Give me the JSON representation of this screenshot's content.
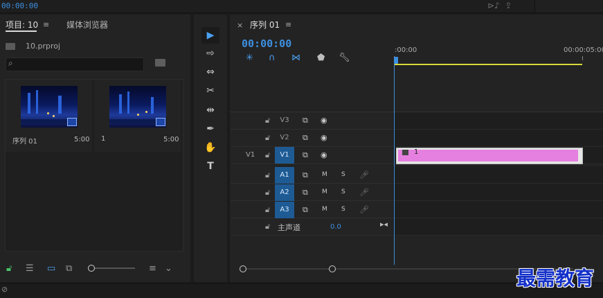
{
  "top_bar": {
    "timecode": "00:00:00"
  },
  "project_panel": {
    "tab_project": "项目: 10",
    "tab_media_browser": "媒体浏览器",
    "project_file": "10.prproj",
    "search_placeholder": "",
    "items": [
      {
        "name": "序列 01",
        "duration": "5:00"
      },
      {
        "name": "1",
        "duration": "5:00"
      }
    ]
  },
  "tools": [
    {
      "icon": "selection-tool-icon",
      "glyph": "▶"
    },
    {
      "icon": "track-select-tool-icon",
      "glyph": "⇨"
    },
    {
      "icon": "ripple-edit-tool-icon",
      "glyph": "↔"
    },
    {
      "icon": "razor-tool-icon",
      "glyph": "✂"
    },
    {
      "icon": "slip-tool-icon",
      "glyph": "⇹"
    },
    {
      "icon": "pen-tool-icon",
      "glyph": "✒"
    },
    {
      "icon": "hand-tool-icon",
      "glyph": "✋"
    },
    {
      "icon": "type-tool-icon",
      "glyph": "T"
    }
  ],
  "timeline": {
    "sequence_tab": "序列 01",
    "timecode": "00:00:00",
    "ruler_start": ":00:00",
    "ruler_end": "00:00:05:00",
    "video_tracks": [
      {
        "source": "",
        "name": "V3"
      },
      {
        "source": "",
        "name": "V2"
      },
      {
        "source": "V1",
        "name": "V1"
      }
    ],
    "audio_tracks": [
      {
        "name": "A1",
        "m": "M",
        "s": "S"
      },
      {
        "name": "A2",
        "m": "M",
        "s": "S"
      },
      {
        "name": "A3",
        "m": "M",
        "s": "S"
      }
    ],
    "master": {
      "label": "主声道",
      "volume": "0.0"
    },
    "clip_label": "1"
  },
  "watermark": "最需教育",
  "colors": {
    "accent": "#3d8fe0",
    "clip": "#e57fe0",
    "workbar": "#d7d93a",
    "track_on": "#1e5b94"
  }
}
